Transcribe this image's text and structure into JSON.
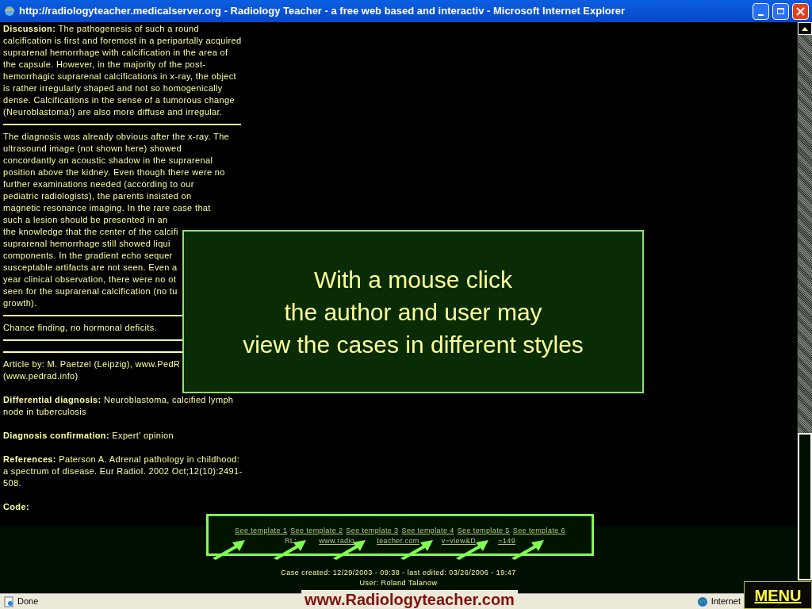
{
  "window": {
    "title": "http://radiologyteacher.medicalserver.org - Radiology Teacher - a free web based and interactiv - Microsoft Internet Explorer"
  },
  "article": {
    "discussion": {
      "label": "Discussion:",
      "text": "The pathogenesis of such a round calcification is first and foremost in a peripartally acquired suprarenal hemorrhage with calcification in the area of the capsule. However, in the majority of the post-hemorrhagic suprarenal calcifications in x-ray, the object is rather irregularly shaped and not so homogenically dense. Calcifications in the sense of a tumorous change (Neuroblastoma!) are also more diffuse and irregular."
    },
    "diagnosis_lines": [
      "The diagnosis was already obvious after the x-ray. The",
      "ultrasound image (not shown here) showed",
      "concordantly an acoustic shadow in the suprarenal",
      "position above the kidney. Even though there were no",
      "further examinations needed (according to our",
      "pediatric radiologists), the parents insisted on",
      "magnetic resonance imaging. In the rare case that",
      "such a lesion should be presented in an",
      "the knowledge that the center of the calcifi",
      "suprarenal hemorrhage still showed liqui",
      "components. In the gradient echo sequer",
      "susceptable artifacts are not seen. Even a",
      "year clinical observation, there were no ot",
      "seen for the suprarenal calcification (no tu",
      "growth)."
    ],
    "chance": "Chance finding, no hormonal deficits.",
    "article_by_lines": [
      "Article by: M. Paetzel (Leipzig), www.PedR",
      "(www.pedrad.info)"
    ],
    "fields": [
      {
        "label": "Differential diagnosis:",
        "text": "Neuroblastoma, calcified lymph node in tuberculosis"
      },
      {
        "label": "Diagnosis confirmation:",
        "text": "Expert' opinion"
      },
      {
        "label": "References:",
        "text": "Paterson A. Adrenal pathology in childhood: a spectrum of disease. Eur Radiol. 2002 Oct;12(10):2491-508."
      },
      {
        "label": "Code:"
      }
    ]
  },
  "overlay": {
    "lines": [
      "With a mouse click",
      "the author and user may",
      "view the cases in different styles"
    ]
  },
  "footer": {
    "template_links": [
      "See template 1",
      "See template 2",
      "See template 3",
      "See template 4",
      "See template 5",
      "See template 6"
    ],
    "url_fragments": [
      {
        "text": "RL:",
        "kind": "plain"
      },
      {
        "text": "www.radio",
        "kind": "link"
      },
      {
        "text": "teacher.com",
        "kind": "link"
      },
      {
        "text": "v=view&D",
        "kind": "link"
      },
      {
        "text": "=149",
        "kind": "link"
      }
    ],
    "case_info": "Case created: 12/29/2003 - 09:38 - last edited: 03/26/2006 - 19:47",
    "user": "User: Roland Talanow"
  },
  "status_bar": {
    "status": "Done",
    "zone": "Internet"
  },
  "banner": "www.Radiologyteacher.com",
  "menu_button": "MENU"
}
